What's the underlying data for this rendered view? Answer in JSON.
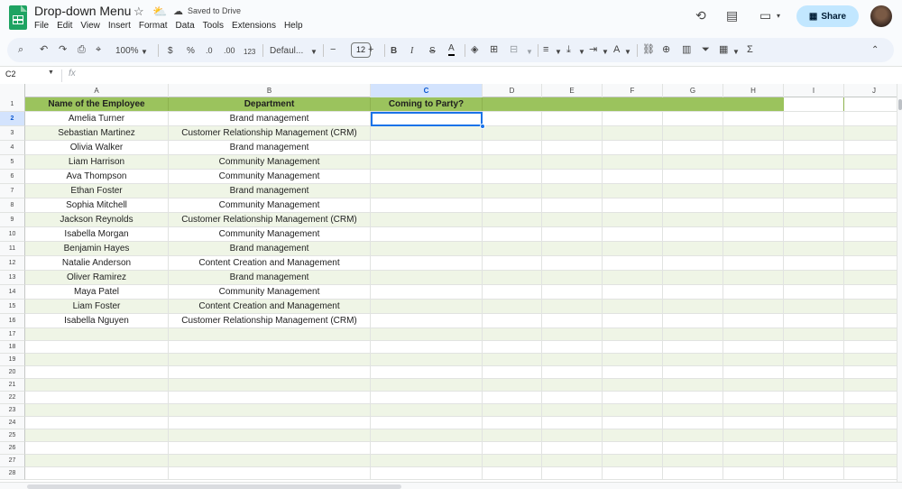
{
  "app": {
    "doc_title": "Drop-down Menu",
    "saved_status": "Saved to Drive",
    "share_label": "Share",
    "star_icon": "star-icon",
    "drive_icon": "cloud-move-icon",
    "saved_icon": "cloud-check-icon"
  },
  "menu": [
    "File",
    "Edit",
    "View",
    "Insert",
    "Format",
    "Data",
    "Tools",
    "Extensions",
    "Help"
  ],
  "toolbar": {
    "zoom": "100%",
    "currency": "$",
    "percent": "%",
    "decrease_decimal": ".0",
    "increase_decimal": ".00",
    "number_format": "123",
    "font": "Defaul...",
    "font_size": "12",
    "bold": "B",
    "italic": "I",
    "strikethrough": "S",
    "text_color": "A",
    "sum": "Σ"
  },
  "formula_bar": {
    "name_box": "C2",
    "fx": "fx",
    "value": ""
  },
  "sheet": {
    "columns": [
      "A",
      "B",
      "C",
      "D",
      "E",
      "F",
      "G",
      "H",
      "I",
      "J"
    ],
    "selected_column": "C",
    "selected_row": "2",
    "header_row": [
      "Name of the Employee",
      "Department",
      "Coming to Party?"
    ],
    "rows": [
      [
        "Amelia Turner",
        "Brand management",
        ""
      ],
      [
        "Sebastian Martinez",
        "Customer Relationship Management (CRM)",
        ""
      ],
      [
        "Olivia Walker",
        "Brand management",
        ""
      ],
      [
        "Liam Harrison",
        "Community Management",
        ""
      ],
      [
        "Ava Thompson",
        "Community Management",
        ""
      ],
      [
        "Ethan Foster",
        "Brand management",
        ""
      ],
      [
        "Sophia Mitchell",
        "Community Management",
        ""
      ],
      [
        "Jackson Reynolds",
        "Customer Relationship Management (CRM)",
        ""
      ],
      [
        "Isabella Morgan",
        "Community Management",
        ""
      ],
      [
        "Benjamin Hayes",
        "Brand management",
        ""
      ],
      [
        "Natalie Anderson",
        "Content Creation and Management",
        ""
      ],
      [
        "Oliver Ramirez",
        "Brand management",
        ""
      ],
      [
        "Maya Patel",
        "Community Management",
        ""
      ],
      [
        "Liam Foster",
        "Content Creation and Management",
        ""
      ],
      [
        "Isabella Nguyen",
        "Customer Relationship Management (CRM)",
        ""
      ]
    ],
    "row_numbers": [
      "1",
      "2",
      "3",
      "4",
      "5",
      "6",
      "7",
      "8",
      "9",
      "10",
      "11",
      "12",
      "13",
      "14",
      "15",
      "16",
      "17",
      "18",
      "19",
      "20",
      "21",
      "22",
      "23",
      "24",
      "25",
      "26",
      "27",
      "28"
    ],
    "colors": {
      "header_fill": "#9bc35d",
      "band_fill": "#eff5e6",
      "selection": "#1a73e8"
    }
  }
}
